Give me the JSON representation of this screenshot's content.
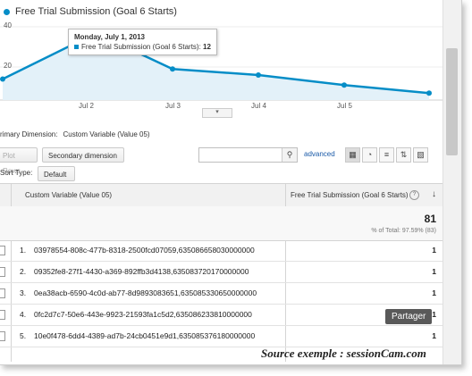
{
  "chart": {
    "legend_label": "Free Trial Submission (Goal 6 Starts)",
    "y_ticks": [
      "40",
      "20"
    ],
    "x_ticks": [
      "Jul 2",
      "Jul 3",
      "Jul 4",
      "Jul 5"
    ],
    "collapse_icon": "▾",
    "colors": {
      "line": "#058dc7",
      "fill": "#e3f1f9"
    },
    "tooltip": {
      "date": "Monday, July 1, 2013",
      "label": "Free Trial Submission (Goal 6 Starts): ",
      "value": "12"
    }
  },
  "chart_data": {
    "type": "area",
    "series": [
      {
        "name": "Free Trial Submission (Goal 6 Starts)",
        "values": [
          14,
          30,
          29,
          19,
          16,
          11,
          7
        ]
      }
    ],
    "ylim": [
      0,
      40
    ],
    "x_tick_labels": [
      "Jul 2",
      "Jul 3",
      "Jul 4",
      "Jul 5"
    ],
    "grid": true
  },
  "controls": {
    "primary_dimension_label": "rimary Dimension:",
    "primary_dimension_value": "Custom Variable (Value 05)",
    "plot_rows": "Plot Rows",
    "secondary_dimension": "Secondary dimension",
    "advanced": "advanced",
    "sort_type_label": "Sort Type:",
    "sort_type_value": "Default"
  },
  "table": {
    "col_dimension": "Custom Variable (Value 05)",
    "col_metric": "Free Trial Submission (Goal 6 Starts)",
    "total_value": "81",
    "total_pct": "% of Total: 97.59% (83)",
    "rows": [
      {
        "num": "1.",
        "value": "03978554-808c-477b-8318-2500fcd07059,635086658030000000",
        "metric": "1"
      },
      {
        "num": "2.",
        "value": "09352fe8-27f1-4430-a369-892ffb3d4138,635083720170000000",
        "metric": "1"
      },
      {
        "num": "3.",
        "value": "0ea38acb-6590-4c0d-ab77-8d9893083651,635085330650000000",
        "metric": "1"
      },
      {
        "num": "4.",
        "value": "0fc2d7c7-50e6-443e-9923-21593fa1c5d2,635086233810000000",
        "metric": "1"
      },
      {
        "num": "5.",
        "value": "10e0f478-6dd4-4389-ad7b-24cb0451e9d1,635085376180000000",
        "metric": "1"
      }
    ]
  },
  "overlay": {
    "share_button": "Partager",
    "caption": "Source exemple : sessionCam.com"
  }
}
